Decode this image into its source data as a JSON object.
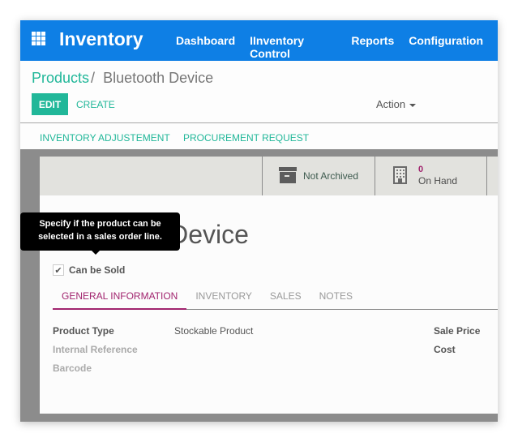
{
  "navbar": {
    "app_name": "Inventory",
    "menu": [
      "Dashboard",
      "IInventory Control",
      "Reports",
      "Configuration"
    ]
  },
  "breadcrumb": {
    "parent": "Products",
    "separator": "/",
    "current": "Bluetooth Device"
  },
  "toolbar": {
    "edit_label": "EDIT",
    "create_label": "CREATE",
    "action_label": "Action"
  },
  "header_buttons": [
    "INVENTORY ADJUSTEMENT",
    "PROCUREMENT REQUEST"
  ],
  "stat_buttons": {
    "archive": {
      "label": "Not Archived",
      "icon": "archive-icon"
    },
    "on_hand": {
      "value": "0",
      "label": "On Hand",
      "icon": "building-icon"
    }
  },
  "product": {
    "title": "Bluetooth Device",
    "can_be_sold_label": "Can be Sold",
    "can_be_sold_checked": true
  },
  "tooltip": {
    "text": "Specify if the product can be selected in a sales order line."
  },
  "tabs": [
    {
      "label": "GENERAL INFORMATION",
      "active": true
    },
    {
      "label": "INVENTORY",
      "active": false
    },
    {
      "label": "SALES",
      "active": false
    },
    {
      "label": "NOTES",
      "active": false
    }
  ],
  "fields": {
    "product_type": {
      "label": "Product Type",
      "value": "Stockable Product"
    },
    "internal_reference": {
      "label": "Internal Reference",
      "value": ""
    },
    "barcode": {
      "label": "Barcode",
      "value": ""
    },
    "sale_price": {
      "label": "Sale Price",
      "value": ""
    },
    "cost": {
      "label": "Cost",
      "value": ""
    }
  },
  "colors": {
    "navbar": "#0e7fe5",
    "primary": "#21b799",
    "accent": "#a1246e"
  }
}
